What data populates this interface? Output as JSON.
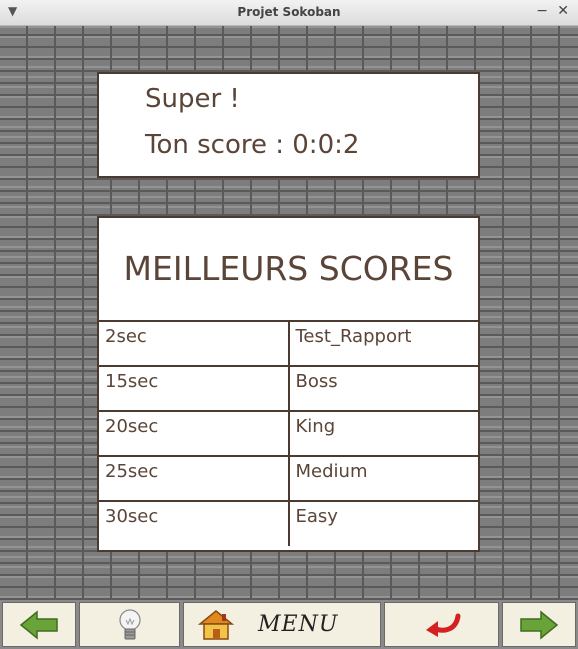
{
  "window": {
    "title": "Projet Sokoban"
  },
  "result": {
    "message": "Super !",
    "score_line": "Ton score : 0:0:2"
  },
  "best_scores": {
    "heading": "MEILLEURS SCORES",
    "rows": [
      {
        "time": "2sec",
        "name": "Test_Rapport"
      },
      {
        "time": "15sec",
        "name": "Boss"
      },
      {
        "time": "20sec",
        "name": "King"
      },
      {
        "time": "25sec",
        "name": "Medium"
      },
      {
        "time": "30sec",
        "name": "Easy"
      }
    ]
  },
  "toolbar": {
    "menu_label": "MENU"
  },
  "colors": {
    "text": "#5a4538",
    "border": "#4a3a30",
    "toolbar_bg": "#f3efe1",
    "arrow_green": "#6aa33a",
    "undo_red": "#d42020"
  }
}
